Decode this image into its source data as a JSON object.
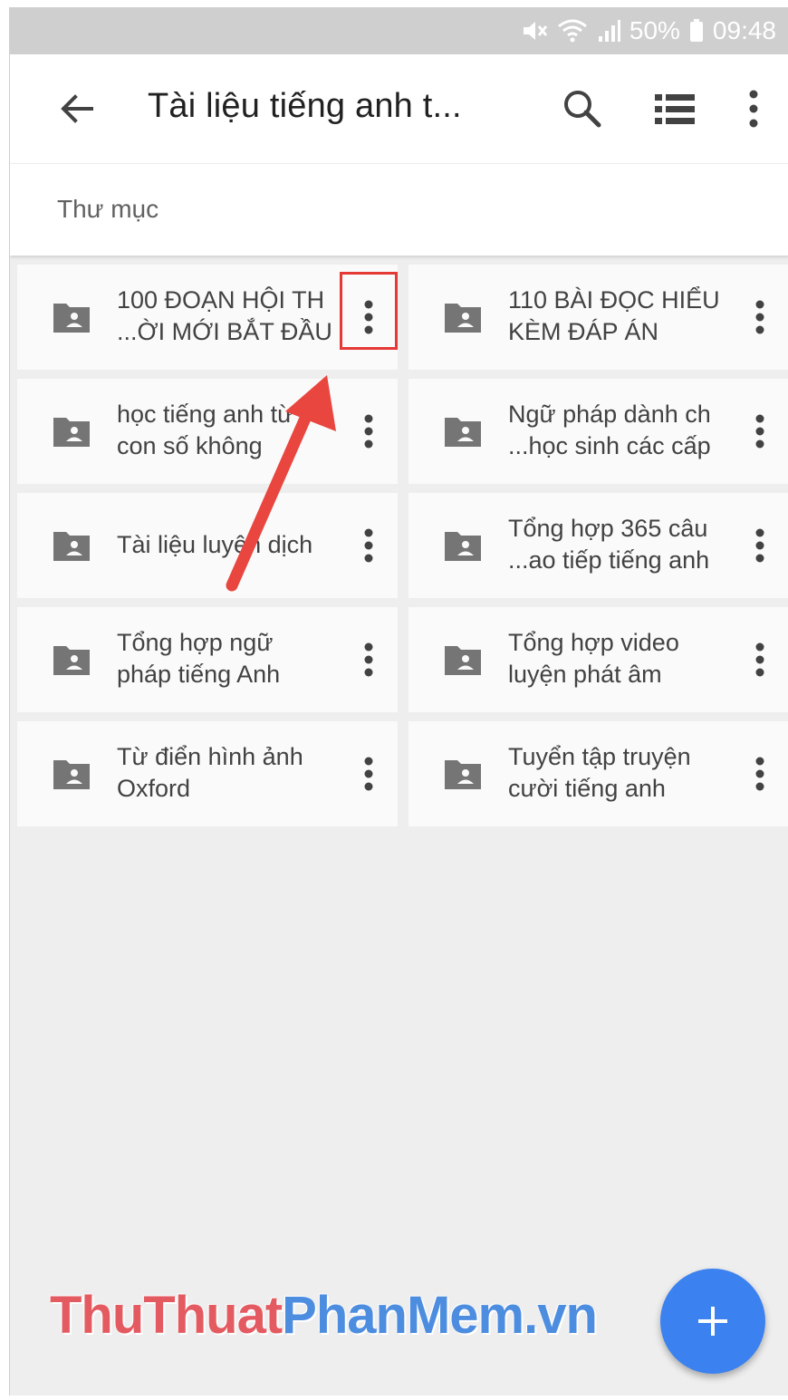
{
  "status_bar": {
    "battery": "50%",
    "time": "09:48",
    "icons": [
      "mute-icon",
      "wifi-icon",
      "signal-icon",
      "battery-icon"
    ]
  },
  "app_bar": {
    "title": "Tài liệu tiếng anh t...",
    "actions": [
      "search-icon",
      "list-view-icon",
      "more-vert-icon"
    ]
  },
  "section": {
    "label": "Thư mục"
  },
  "folders": [
    {
      "name": "100 ĐOẠN HỘI TH\n...ỜI MỚI BẮT ĐẦU"
    },
    {
      "name": "110 BÀI ĐỌC HIỂU\nKÈM ĐÁP ÁN"
    },
    {
      "name": "học tiếng anh từ\ncon số không"
    },
    {
      "name": "Ngữ pháp dành ch\n...học sinh các cấp"
    },
    {
      "name": "Tài liệu luyện dịch"
    },
    {
      "name": "Tổng hợp 365 câu\n...ao tiếp tiếng anh"
    },
    {
      "name": "Tổng hợp ngữ\npháp tiếng Anh"
    },
    {
      "name": "Tổng hợp video\nluyện phát âm"
    },
    {
      "name": "Từ điển hình ảnh\nOxford"
    },
    {
      "name": "Tuyển tập truyện\ncười tiếng anh"
    }
  ],
  "watermark": {
    "part1": "ThuThuat",
    "part2": "PhanMem.vn"
  },
  "colors": {
    "accent": "#3b82f0",
    "highlight": "#e53935",
    "icon": "#757575"
  }
}
